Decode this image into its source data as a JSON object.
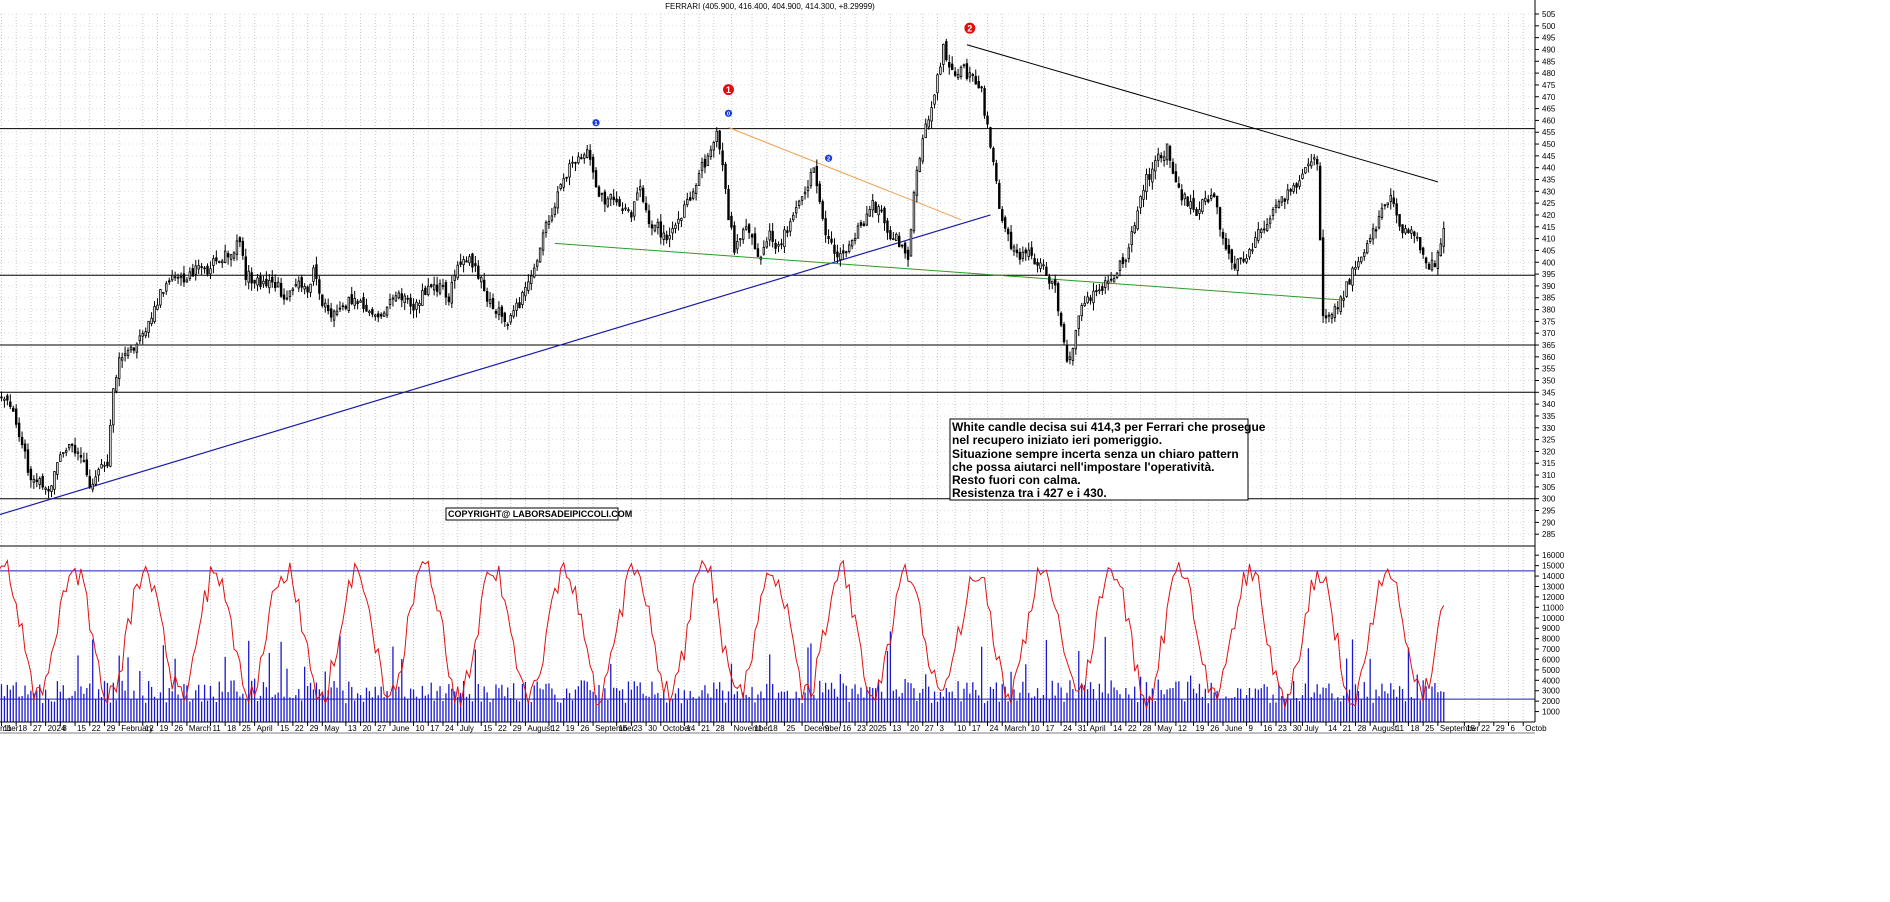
{
  "chart_data": [
    {
      "type": "candlestick",
      "title": "FERRARI (405.900, 416.400, 404.900, 414.300, +8.29999)",
      "ylim": [
        280,
        505
      ],
      "y_ticks": [
        285,
        290,
        295,
        300,
        305,
        310,
        315,
        320,
        325,
        330,
        335,
        340,
        345,
        350,
        355,
        360,
        365,
        370,
        375,
        380,
        385,
        390,
        395,
        400,
        405,
        410,
        415,
        420,
        425,
        430,
        435,
        440,
        445,
        450,
        455,
        460,
        465,
        470,
        475,
        480,
        485,
        490,
        495,
        500,
        505
      ],
      "x_labels": [
        {
          "t": 0,
          "text": "cember"
        },
        {
          "t": 4,
          "text": "11"
        },
        {
          "t": 9,
          "text": "18"
        },
        {
          "t": 14,
          "text": "27"
        },
        {
          "t": 19,
          "text": "2024"
        },
        {
          "t": 24,
          "text": "8"
        },
        {
          "t": 29,
          "text": "15"
        },
        {
          "t": 34,
          "text": "22"
        },
        {
          "t": 39,
          "text": "29"
        },
        {
          "t": 44,
          "text": "February"
        },
        {
          "t": 52,
          "text": "12"
        },
        {
          "t": 57,
          "text": "19"
        },
        {
          "t": 62,
          "text": "26"
        },
        {
          "t": 67,
          "text": "March"
        },
        {
          "t": 75,
          "text": "11"
        },
        {
          "t": 80,
          "text": "18"
        },
        {
          "t": 85,
          "text": "25"
        },
        {
          "t": 90,
          "text": "April"
        },
        {
          "t": 98,
          "text": "15"
        },
        {
          "t": 103,
          "text": "22"
        },
        {
          "t": 108,
          "text": "29"
        },
        {
          "t": 113,
          "text": "May"
        },
        {
          "t": 121,
          "text": "13"
        },
        {
          "t": 126,
          "text": "20"
        },
        {
          "t": 131,
          "text": "27"
        },
        {
          "t": 136,
          "text": "June"
        },
        {
          "t": 144,
          "text": "10"
        },
        {
          "t": 149,
          "text": "17"
        },
        {
          "t": 154,
          "text": "24"
        },
        {
          "t": 159,
          "text": "July"
        },
        {
          "t": 167,
          "text": "15"
        },
        {
          "t": 172,
          "text": "22"
        },
        {
          "t": 177,
          "text": "29"
        },
        {
          "t": 182,
          "text": "August"
        },
        {
          "t": 190,
          "text": "12"
        },
        {
          "t": 195,
          "text": "19"
        },
        {
          "t": 200,
          "text": "26"
        },
        {
          "t": 205,
          "text": "September"
        },
        {
          "t": 213,
          "text": "16"
        },
        {
          "t": 218,
          "text": "23"
        },
        {
          "t": 223,
          "text": "30"
        },
        {
          "t": 228,
          "text": "October"
        },
        {
          "t": 236,
          "text": "14"
        },
        {
          "t": 241,
          "text": "21"
        },
        {
          "t": 246,
          "text": "28"
        },
        {
          "t": 252,
          "text": "November"
        },
        {
          "t": 259,
          "text": "11"
        },
        {
          "t": 264,
          "text": "18"
        },
        {
          "t": 270,
          "text": "25"
        },
        {
          "t": 276,
          "text": "December"
        },
        {
          "t": 283,
          "text": "9"
        },
        {
          "t": 289,
          "text": "16"
        },
        {
          "t": 294,
          "text": "23"
        },
        {
          "t": 298,
          "text": "2025"
        },
        {
          "t": 306,
          "text": "13"
        },
        {
          "t": 312,
          "text": "20"
        },
        {
          "t": 317,
          "text": "27"
        },
        {
          "t": 322,
          "text": "3"
        },
        {
          "t": 328,
          "text": "10"
        },
        {
          "t": 333,
          "text": "17"
        },
        {
          "t": 339,
          "text": "24"
        },
        {
          "t": 344,
          "text": "March"
        },
        {
          "t": 353,
          "text": "10"
        },
        {
          "t": 358,
          "text": "17"
        },
        {
          "t": 364,
          "text": "24"
        },
        {
          "t": 369,
          "text": "31"
        },
        {
          "t": 373,
          "text": "April"
        },
        {
          "t": 381,
          "text": "14"
        },
        {
          "t": 386,
          "text": "22"
        },
        {
          "t": 391,
          "text": "28"
        },
        {
          "t": 396,
          "text": "May"
        },
        {
          "t": 403,
          "text": "12"
        },
        {
          "t": 409,
          "text": "19"
        },
        {
          "t": 414,
          "text": "26"
        },
        {
          "t": 419,
          "text": "June"
        },
        {
          "t": 427,
          "text": "9"
        },
        {
          "t": 432,
          "text": "16"
        },
        {
          "t": 437,
          "text": "23"
        },
        {
          "t": 442,
          "text": "30"
        },
        {
          "t": 446,
          "text": "July"
        },
        {
          "t": 454,
          "text": "14"
        },
        {
          "t": 459,
          "text": "21"
        },
        {
          "t": 464,
          "text": "28"
        },
        {
          "t": 469,
          "text": "August"
        },
        {
          "t": 477,
          "text": "11"
        },
        {
          "t": 482,
          "text": "18"
        },
        {
          "t": 487,
          "text": "25"
        },
        {
          "t": 492,
          "text": "September"
        },
        {
          "t": 501,
          "text": "15"
        },
        {
          "t": 506,
          "text": "22"
        },
        {
          "t": 511,
          "text": "29"
        },
        {
          "t": 516,
          "text": "6"
        },
        {
          "t": 521,
          "text": "Octob"
        }
      ],
      "anchors": [
        [
          0,
          340
        ],
        [
          6,
          343
        ],
        [
          9,
          333
        ],
        [
          12,
          318
        ],
        [
          14,
          308
        ],
        [
          18,
          306
        ],
        [
          20,
          304
        ],
        [
          24,
          318
        ],
        [
          28,
          322
        ],
        [
          32,
          317
        ],
        [
          34,
          307
        ],
        [
          37,
          310
        ],
        [
          40,
          316
        ],
        [
          42,
          345
        ],
        [
          44,
          358
        ],
        [
          47,
          362
        ],
        [
          52,
          368
        ],
        [
          55,
          375
        ],
        [
          58,
          388
        ],
        [
          62,
          395
        ],
        [
          66,
          392
        ],
        [
          70,
          398
        ],
        [
          74,
          397
        ],
        [
          78,
          402
        ],
        [
          82,
          404
        ],
        [
          85,
          408
        ],
        [
          87,
          395
        ],
        [
          92,
          390
        ],
        [
          96,
          392
        ],
        [
          101,
          385
        ],
        [
          104,
          392
        ],
        [
          108,
          388
        ],
        [
          110,
          398
        ],
        [
          112,
          386
        ],
        [
          116,
          376
        ],
        [
          119,
          380
        ],
        [
          124,
          386
        ],
        [
          127,
          380
        ],
        [
          131,
          377
        ],
        [
          134,
          380
        ],
        [
          139,
          385
        ],
        [
          144,
          382
        ],
        [
          149,
          388
        ],
        [
          153,
          390
        ],
        [
          156,
          385
        ],
        [
          159,
          398
        ],
        [
          163,
          402
        ],
        [
          166,
          395
        ],
        [
          169,
          386
        ],
        [
          172,
          380
        ],
        [
          175,
          375
        ],
        [
          178,
          378
        ],
        [
          181,
          385
        ],
        [
          184,
          392
        ],
        [
          188,
          412
        ],
        [
          191,
          420
        ],
        [
          194,
          432
        ],
        [
          197,
          440
        ],
        [
          200,
          444
        ],
        [
          203,
          448
        ],
        [
          206,
          432
        ],
        [
          209,
          425
        ],
        [
          212,
          428
        ],
        [
          215,
          422
        ],
        [
          218,
          420
        ],
        [
          221,
          432
        ],
        [
          224,
          418
        ],
        [
          227,
          415
        ],
        [
          230,
          408
        ],
        [
          233,
          415
        ],
        [
          236,
          422
        ],
        [
          239,
          432
        ],
        [
          242,
          440
        ],
        [
          245,
          448
        ],
        [
          247,
          455
        ],
        [
          249,
          442
        ],
        [
          251,
          420
        ],
        [
          253,
          405
        ],
        [
          256,
          415
        ],
        [
          259,
          410
        ],
        [
          262,
          400
        ],
        [
          265,
          412
        ],
        [
          268,
          405
        ],
        [
          271,
          415
        ],
        [
          274,
          425
        ],
        [
          277,
          432
        ],
        [
          280,
          438
        ],
        [
          282,
          428
        ],
        [
          284,
          412
        ],
        [
          287,
          405
        ],
        [
          290,
          402
        ],
        [
          293,
          410
        ],
        [
          297,
          418
        ],
        [
          300,
          425
        ],
        [
          303,
          420
        ],
        [
          306,
          412
        ],
        [
          309,
          408
        ],
        [
          312,
          402
        ],
        [
          314,
          428
        ],
        [
          316,
          445
        ],
        [
          318,
          458
        ],
        [
          320,
          465
        ],
        [
          322,
          478
        ],
        [
          324,
          490
        ],
        [
          326,
          485
        ],
        [
          328,
          480
        ],
        [
          330,
          483
        ],
        [
          332,
          480
        ],
        [
          334,
          478
        ],
        [
          337,
          472
        ],
        [
          340,
          450
        ],
        [
          342,
          432
        ],
        [
          344,
          418
        ],
        [
          347,
          408
        ],
        [
          350,
          402
        ],
        [
          353,
          405
        ],
        [
          356,
          400
        ],
        [
          359,
          396
        ],
        [
          362,
          388
        ],
        [
          364,
          372
        ],
        [
          366,
          358
        ],
        [
          368,
          362
        ],
        [
          370,
          378
        ],
        [
          373,
          385
        ],
        [
          377,
          388
        ],
        [
          380,
          392
        ],
        [
          383,
          396
        ],
        [
          386,
          402
        ],
        [
          389,
          418
        ],
        [
          392,
          432
        ],
        [
          395,
          440
        ],
        [
          398,
          446
        ],
        [
          400,
          448
        ],
        [
          402,
          440
        ],
        [
          404,
          430
        ],
        [
          407,
          425
        ],
        [
          410,
          422
        ],
        [
          413,
          425
        ],
        [
          416,
          428
        ],
        [
          419,
          410
        ],
        [
          422,
          398
        ],
        [
          425,
          400
        ],
        [
          428,
          405
        ],
        [
          431,
          412
        ],
        [
          434,
          418
        ],
        [
          437,
          422
        ],
        [
          440,
          428
        ],
        [
          443,
          432
        ],
        [
          446,
          438
        ],
        [
          449,
          444
        ],
        [
          451,
          440
        ],
        [
          453,
          375
        ],
        [
          456,
          380
        ],
        [
          459,
          384
        ],
        [
          462,
          392
        ],
        [
          465,
          402
        ],
        [
          468,
          408
        ],
        [
          471,
          415
        ],
        [
          474,
          425
        ],
        [
          476,
          428
        ],
        [
          478,
          420
        ],
        [
          480,
          412
        ],
        [
          483,
          415
        ],
        [
          486,
          405
        ],
        [
          489,
          398
        ],
        [
          492,
          402
        ],
        [
          494,
          414.3
        ]
      ],
      "annotations": {
        "wave_labels": [
          {
            "t": 206,
            "price": 459,
            "text": "1",
            "color": "#1a3bd6",
            "size": "small"
          },
          {
            "t": 251,
            "price": 463,
            "text": "0",
            "color": "#1a3bd6",
            "size": "small"
          },
          {
            "t": 285,
            "price": 444,
            "text": "2",
            "color": "#1a3bd6",
            "size": "small"
          },
          {
            "t": 251,
            "price": 473,
            "text": "1",
            "color": "#e01010",
            "size": "large"
          },
          {
            "t": 333,
            "price": 499,
            "text": "2",
            "color": "#e01010",
            "size": "large"
          }
        ],
        "note_lines": [
          "White candle decisa sui 414,3 per Ferrari che prosegue",
          "nel recupero iniziato ieri pomeriggio.",
          "Situazione sempre incerta senza un chiaro pattern",
          "che possa aiutarci nell'impostare l'operatività.",
          "Resto fuori con calma.",
          "Resistenza tra i 427 e i 430."
        ],
        "copyright": "COPYRIGHT@ LABORSADEIPICCOLI.COM"
      },
      "lines": {
        "horizontal_black": [
          456.5,
          345,
          300,
          365,
          394.5
        ],
        "support_blue": [
          [
            0,
            292
          ],
          [
            340,
            420
          ]
        ],
        "resistance_black": [
          [
            332,
            492
          ],
          [
            492,
            434
          ]
        ],
        "orange": [
          [
            251,
            457
          ],
          [
            330,
            418
          ]
        ],
        "green": [
          [
            192,
            408
          ],
          [
            460,
            384
          ]
        ]
      }
    },
    {
      "type": "line+bar",
      "ylim": [
        0,
        16500
      ],
      "y_ticks": [
        1000,
        2000,
        3000,
        4000,
        5000,
        6000,
        7000,
        8000,
        9000,
        10000,
        11000,
        12000,
        13000,
        14000,
        15000,
        16000
      ],
      "series": [
        {
          "kind": "bar",
          "color": "#1a1acc"
        },
        {
          "kind": "line",
          "color": "#e01010"
        }
      ]
    }
  ]
}
